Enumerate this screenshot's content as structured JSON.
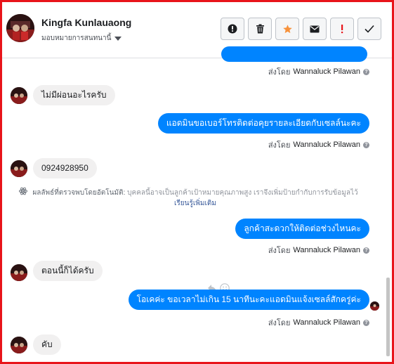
{
  "header": {
    "contact_name": "Kingfa Kunlauaong",
    "assign_label": "มอบหมายการสนทนานี้",
    "actions": [
      {
        "name": "mark-spam-button",
        "icon": "exclamation-circle-icon"
      },
      {
        "name": "delete-button",
        "icon": "trash-icon"
      },
      {
        "name": "star-button",
        "icon": "star-icon"
      },
      {
        "name": "mark-unread-button",
        "icon": "envelope-icon"
      },
      {
        "name": "follow-up-button",
        "icon": "exclamation-icon"
      },
      {
        "name": "mark-done-button",
        "icon": "checkmark-icon"
      }
    ]
  },
  "messages": {
    "sent_by_prefix": "ส่งโดย",
    "agent_name": "Wannaluck Pilawan",
    "m1": "ไม่มีผ่อนอะไรครับ",
    "m2": "แอดมินขอเบอร์โทรติดต่อคุยรายละเอียดกับเซลล์นะคะ",
    "m3": "0924928950",
    "detect_label": "ผลลัพธ์ที่ตรวจพบโดยอัตโนมัติ:",
    "detect_text": "บุคคลนี้อาจเป็นลูกค้าเป้าหมายคุณภาพสูง เราจึงเพิ่มป้ายกำกับการรับข้อมูลไว้",
    "detect_link": "เรียนรู้เพิ่มเติม",
    "m4": "ลูกค้าสะดวกให้ติดต่อช่วงไหนคะ",
    "m5": "ตอนนี้ก็ได้ครับ",
    "m6": "โอเคค่ะ ขอเวลาไม่เกิน 15 นาทีนะคะแอดมินแจ้งเซลล์สักครู่ค่ะ",
    "m7": "คับ"
  },
  "colors": {
    "accent": "#0084ff",
    "border": "#e8141a",
    "star": "#f7923b",
    "follow_up": "#e8141a"
  }
}
